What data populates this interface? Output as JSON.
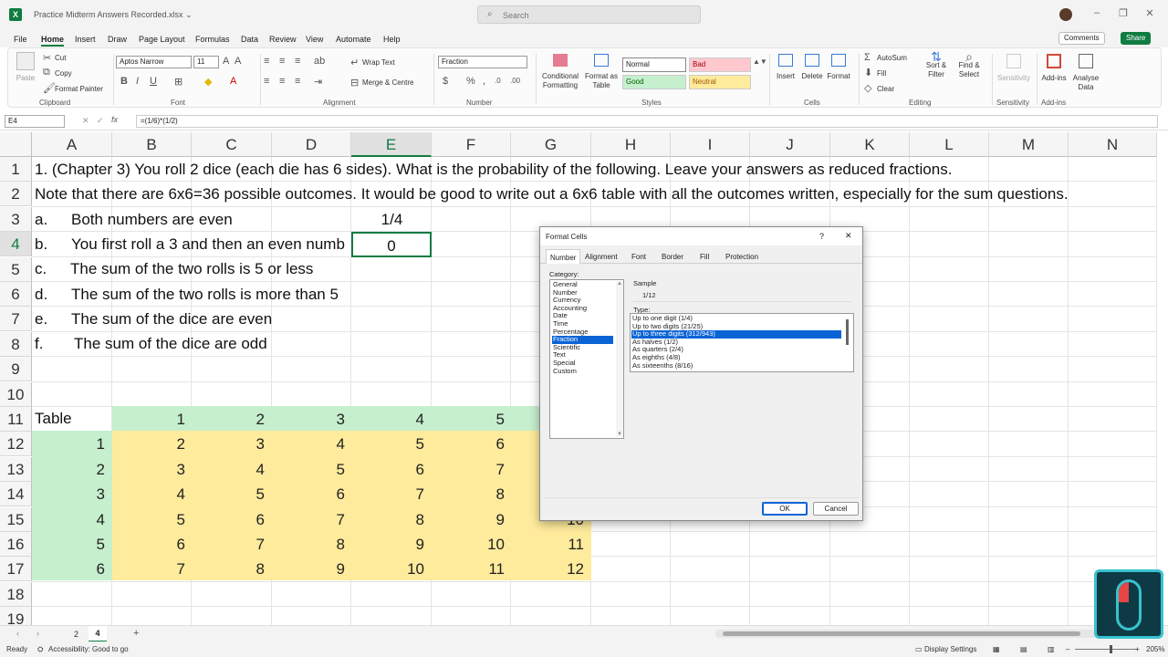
{
  "window": {
    "app_icon": "X",
    "title": "Practice Midterm Answers Recorded.xlsx",
    "search_placeholder": "Search"
  },
  "menu": {
    "items": [
      "File",
      "Home",
      "Insert",
      "Draw",
      "Page Layout",
      "Formulas",
      "Data",
      "Review",
      "View",
      "Automate",
      "Help"
    ],
    "active": "Home"
  },
  "top_buttons": {
    "comments": "Comments",
    "share": "Share"
  },
  "ribbon": {
    "clipboard": {
      "paste": "Paste",
      "cut": "Cut",
      "copy": "Copy",
      "format_painter": "Format Painter",
      "label": "Clipboard"
    },
    "font": {
      "name": "Aptos Narrow",
      "size": "11",
      "label": "Font"
    },
    "alignment": {
      "wrap_text": "Wrap Text",
      "merge_centre": "Merge & Centre",
      "label": "Alignment"
    },
    "number": {
      "format": "Fraction",
      "label": "Number"
    },
    "styles": {
      "conditional": "Conditional Formatting",
      "format_table": "Format as Table",
      "normal": "Normal",
      "bad": "Bad",
      "good": "Good",
      "neutral": "Neutral",
      "label": "Styles"
    },
    "cells": {
      "insert": "Insert",
      "delete": "Delete",
      "format": "Format",
      "label": "Cells"
    },
    "editing": {
      "autosum": "AutoSum",
      "fill": "Fill",
      "clear": "Clear",
      "sort_filter": "Sort & Filter",
      "find_select": "Find & Select",
      "label": "Editing"
    },
    "sensitivity": {
      "btn": "Sensitivity",
      "label": "Sensitivity"
    },
    "addins": {
      "btn": "Add-ins",
      "analyse": "Analyse Data",
      "label": "Add-ins"
    }
  },
  "formula_bar": {
    "name_box": "E4",
    "formula": "=(1/6)*(1/2)"
  },
  "columns": [
    "A",
    "B",
    "C",
    "D",
    "E",
    "F",
    "G",
    "H",
    "I",
    "J",
    "K",
    "L",
    "M",
    "N"
  ],
  "rows": [
    "1",
    "2",
    "3",
    "4",
    "5",
    "6",
    "7",
    "8",
    "9",
    "10",
    "11",
    "12",
    "13",
    "14",
    "15",
    "16",
    "17",
    "18",
    "19"
  ],
  "cells": {
    "r1": "1.     (Chapter 3) You roll 2 dice (each die has 6 sides). What is the probability of the following. Leave your answers as reduced fractions.",
    "r2": "Note that there are 6x6=36 possible outcomes. It would be good to write out a 6x6 table with all the outcomes written, especially for the sum questions.",
    "r3a": "a.",
    "r3b": "Both numbers are even",
    "r3e": "1/4",
    "r4a": "b.",
    "r4b": "You first roll a 3 and then an even numb",
    "r4e": "0",
    "r5a": "c.",
    "r5b": "The sum of the two rolls is 5 or less",
    "r6a": "d.",
    "r6b": "The sum of the two rolls is more than 5",
    "r7a": "e.",
    "r7b": "The sum of the dice are even",
    "r8a": "f.",
    "r8b": "The sum of the dice are odd",
    "table_label": "Table",
    "header": [
      "1",
      "2",
      "3",
      "4",
      "5"
    ],
    "rows_idx": [
      "1",
      "2",
      "3",
      "4",
      "5",
      "6"
    ],
    "table": [
      [
        "2",
        "3",
        "4",
        "5",
        "6"
      ],
      [
        "3",
        "4",
        "5",
        "6",
        "7"
      ],
      [
        "4",
        "5",
        "6",
        "7",
        "8"
      ],
      [
        "5",
        "6",
        "7",
        "8",
        "9",
        "10"
      ],
      [
        "6",
        "7",
        "8",
        "9",
        "10",
        "11"
      ],
      [
        "7",
        "8",
        "9",
        "10",
        "11",
        "12"
      ]
    ]
  },
  "dialog": {
    "title": "Format Cells",
    "help": "?",
    "close": "✕",
    "tabs": [
      "Number",
      "Alignment",
      "Font",
      "Border",
      "Fill",
      "Protection"
    ],
    "category_label": "Category:",
    "categories": [
      "General",
      "Number",
      "Currency",
      "Accounting",
      "Date",
      "Time",
      "Percentage",
      "Fraction",
      "Scientific",
      "Text",
      "Special",
      "Custom"
    ],
    "selected_category": "Fraction",
    "sample_label": "Sample",
    "sample_value": "1/12",
    "type_label": "Type:",
    "types": [
      "Up to one digit (1/4)",
      "Up to two digits (21/25)",
      "Up to three digits (312/943)",
      "As halves (1/2)",
      "As quarters (2/4)",
      "As eighths (4/8)",
      "As sixteenths (8/16)"
    ],
    "selected_type": "Up to three digits (312/943)",
    "ok": "OK",
    "cancel": "Cancel"
  },
  "sheet_tabs": [
    "2",
    "4"
  ],
  "active_sheet": "4",
  "status": {
    "ready": "Ready",
    "accessibility": "Accessibility: Good to go",
    "display_settings": "Display Settings",
    "zoom": "205%"
  },
  "colors": {
    "excel_green": "#107c41",
    "table_header": "#c6efce",
    "table_body": "#ffeb9c",
    "selection": "#0a64d6"
  }
}
